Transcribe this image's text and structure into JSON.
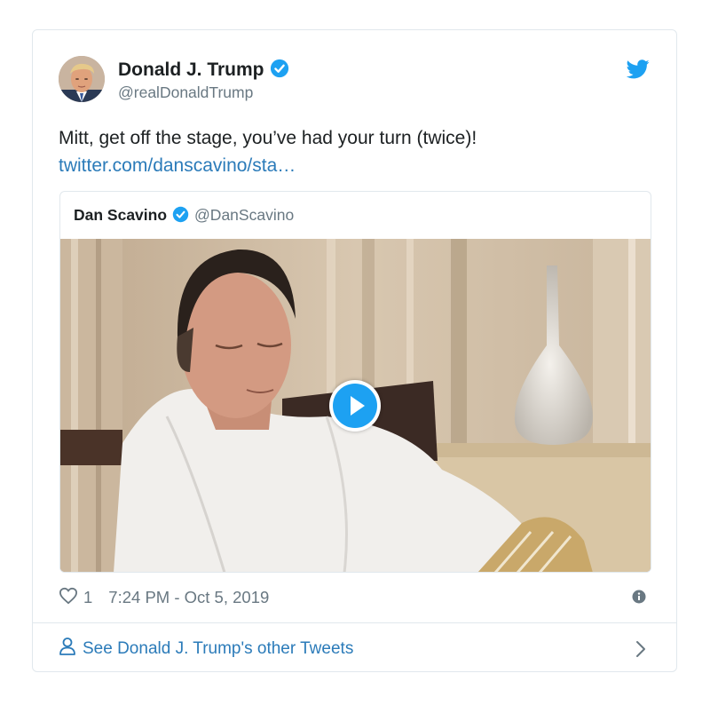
{
  "tweet": {
    "author_name": "Donald J. Trump",
    "author_handle": "@realDonaldTrump",
    "text": "Mitt, get off the stage, you’ve had your turn (twice)!",
    "link": "twitter.com/danscavino/sta…",
    "like_count": "1",
    "timestamp": "7:24 PM - Oct 5, 2019",
    "avatar_icon": "avatar-photo",
    "verified_icon": "verified-badge-icon",
    "brand_icon": "twitter-bird-icon"
  },
  "quote": {
    "author_name": "Dan Scavino",
    "author_handle": "@DanScavino",
    "media_icon": "video-thumbnail",
    "play_icon": "play-icon"
  },
  "footer": {
    "label": "See Donald J. Trump's other Tweets",
    "user_icon": "user-icon",
    "chevron_icon": "chevron-right-icon"
  },
  "colors": {
    "accent": "#1da1f2",
    "link": "#2b7bb9",
    "text": "#1c2022",
    "secondary": "#697882",
    "border": "#e1e8ed"
  }
}
